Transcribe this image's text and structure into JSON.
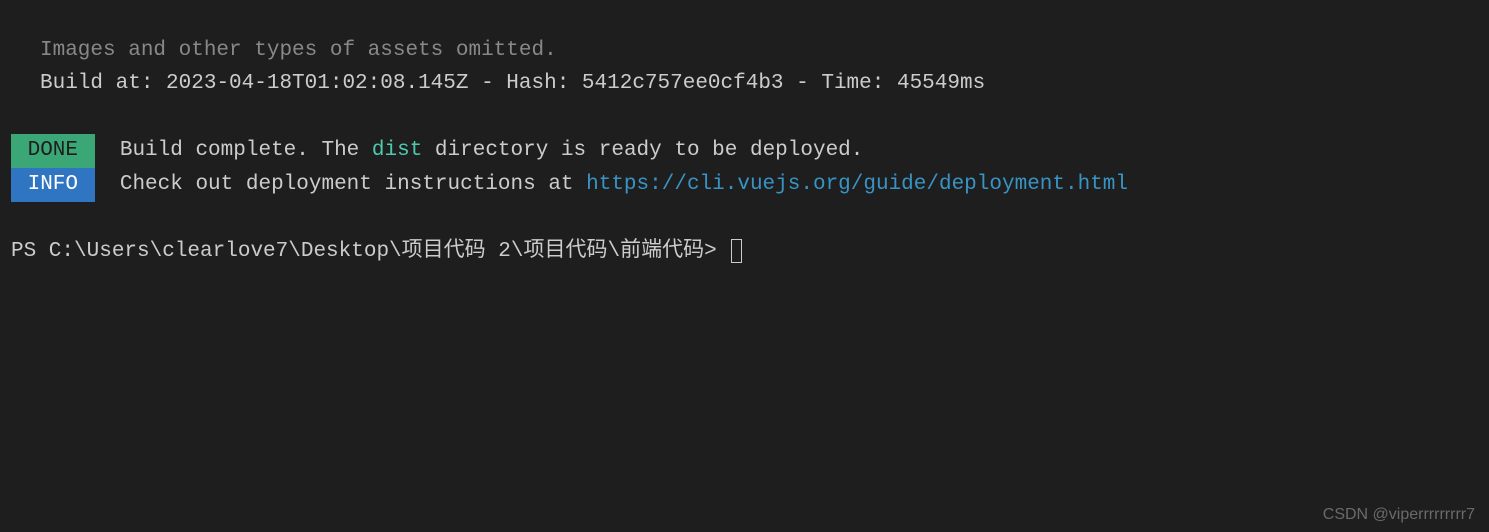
{
  "output": {
    "omitted_line": "Images and other types of assets omitted.",
    "build_at_label": "Build at: ",
    "build_at_value": "2023-04-18T01:02:08.145Z",
    "hash_sep": " - Hash: ",
    "hash_value": "5412c757ee0cf4b3",
    "time_sep": " - Time: ",
    "time_value": "45549ms"
  },
  "done": {
    "badge": " DONE ",
    "msg_pre": "Build complete. The ",
    "dist": "dist",
    "msg_post": " directory is ready to be deployed."
  },
  "info": {
    "badge": " INFO ",
    "msg_pre": "Check out deployment instructions at ",
    "url": "https://cli.vuejs.org/guide/deployment.html"
  },
  "prompt": {
    "text": "PS C:\\Users\\clearlove7\\Desktop\\项目代码 2\\项目代码\\前端代码> "
  },
  "watermark": "CSDN @viperrrrrrrrr7"
}
